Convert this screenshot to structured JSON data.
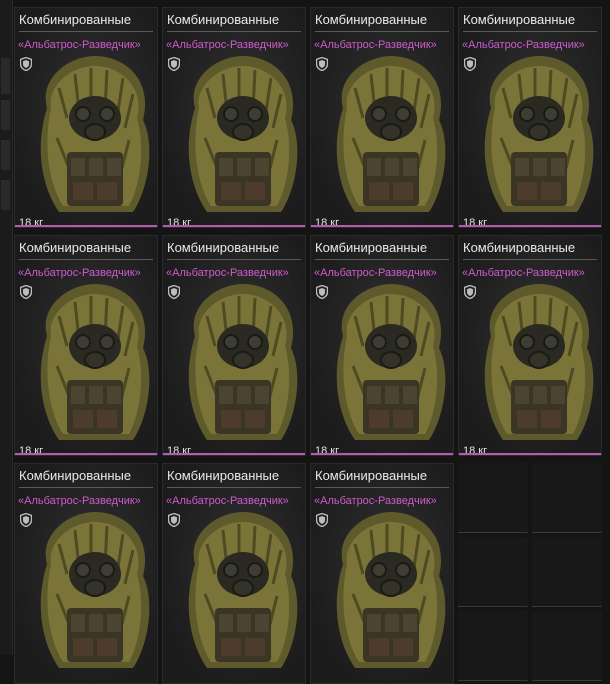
{
  "items": [
    {
      "name": "Комбинированные",
      "subtitle": "«Альбатрос-Разведчик»",
      "weight": "18 кг",
      "shield_icon": "shield-icon"
    },
    {
      "name": "Комбинированные",
      "subtitle": "«Альбатрос-Разведчик»",
      "weight": "18 кг",
      "shield_icon": "shield-icon"
    },
    {
      "name": "Комбинированные",
      "subtitle": "«Альбатрос-Разведчик»",
      "weight": "18 кг",
      "shield_icon": "shield-icon"
    },
    {
      "name": "Комбинированные",
      "subtitle": "«Альбатрос-Разведчик»",
      "weight": "18 кг",
      "shield_icon": "shield-icon"
    },
    {
      "name": "Комбинированные",
      "subtitle": "«Альбатрос-Разведчик»",
      "weight": "18 кг",
      "shield_icon": "shield-icon"
    },
    {
      "name": "Комбинированные",
      "subtitle": "«Альбатрос-Разведчик»",
      "weight": "18 кг",
      "shield_icon": "shield-icon"
    },
    {
      "name": "Комбинированные",
      "subtitle": "«Альбатрос-Разведчик»",
      "weight": "18 кг",
      "shield_icon": "shield-icon"
    },
    {
      "name": "Комбинированные",
      "subtitle": "«Альбатрос-Разведчик»",
      "weight": "18 кг",
      "shield_icon": "shield-icon"
    },
    {
      "name": "Комбинированные",
      "subtitle": "«Альбатрос-Разведчик»",
      "weight": "",
      "shield_icon": "shield-icon"
    },
    {
      "name": "Комбинированные",
      "subtitle": "«Альбатрос-Разведчик»",
      "weight": "",
      "shield_icon": "shield-icon"
    },
    {
      "name": "Комбинированные",
      "subtitle": "«Альбатрос-Разведчик»",
      "weight": "",
      "shield_icon": "shield-icon"
    }
  ],
  "colors": {
    "subtitle": "#d05ad0",
    "accent_line": "#b45cb4",
    "name": "#e9e9e9",
    "background": "#141414"
  }
}
